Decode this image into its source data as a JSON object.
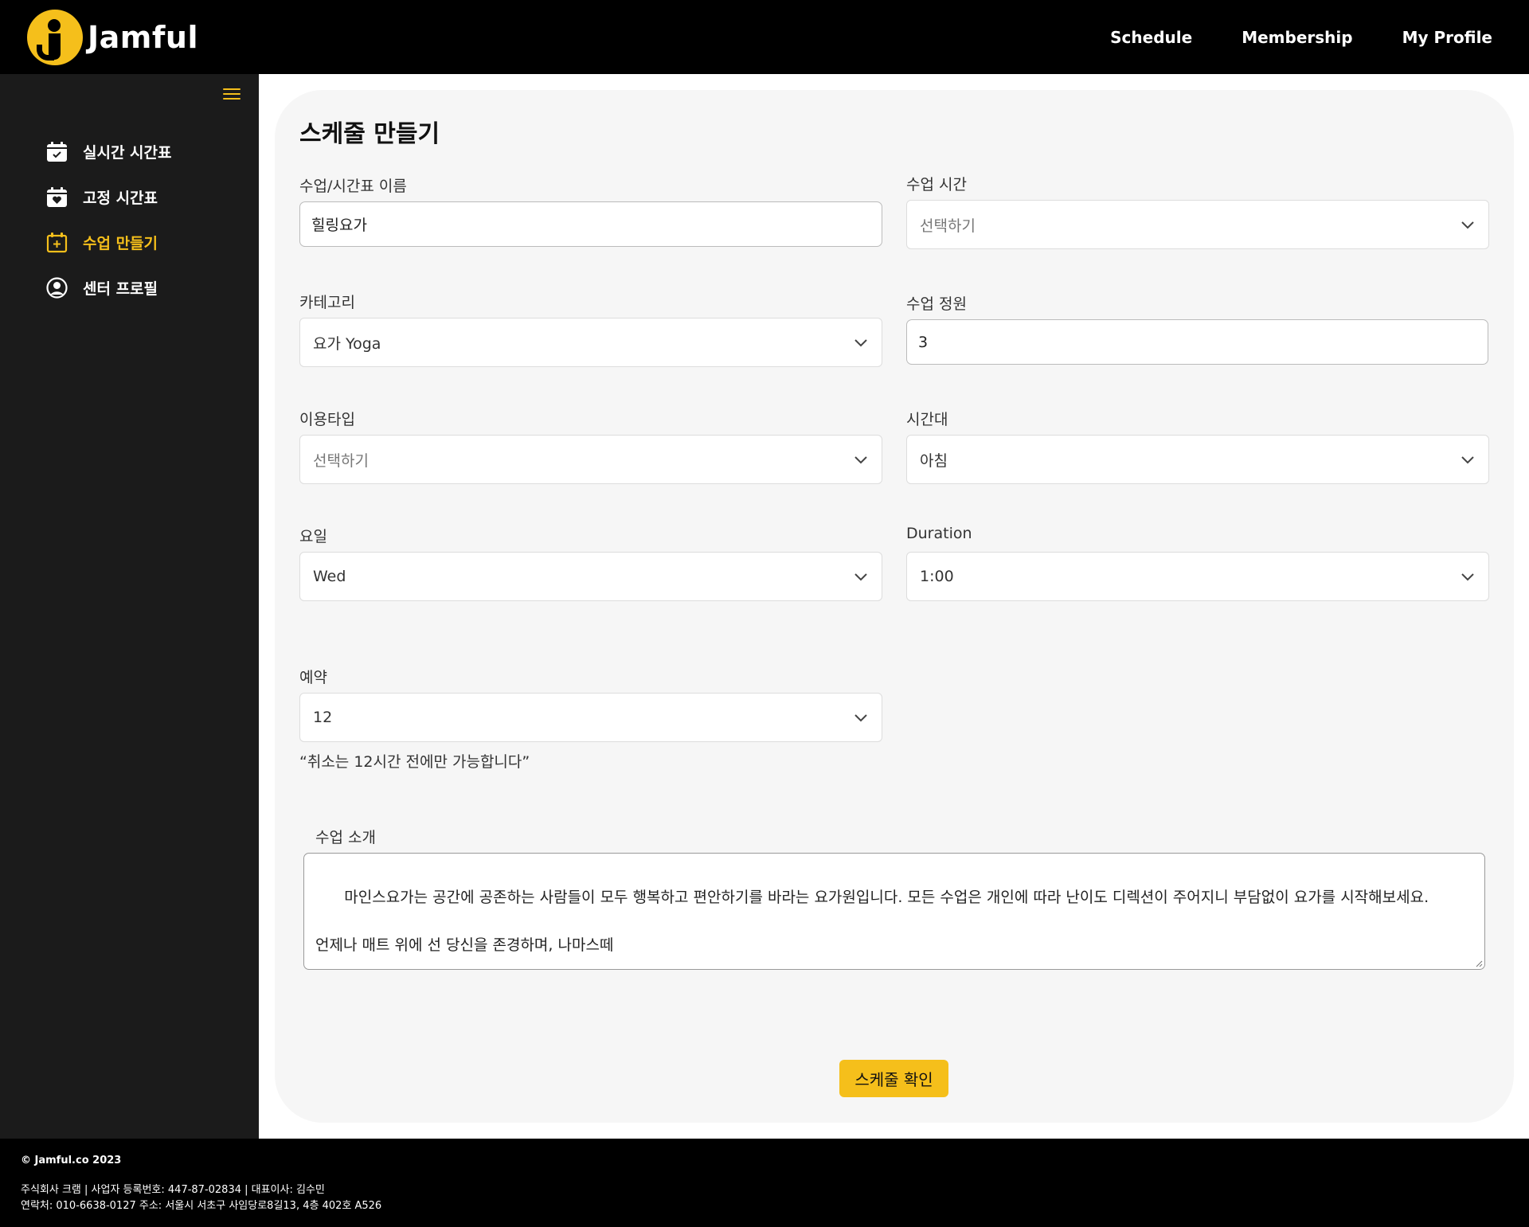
{
  "header": {
    "logo_text": "Jamful",
    "nav": [
      {
        "label": "Schedule"
      },
      {
        "label": "Membership"
      },
      {
        "label": "My Profile"
      }
    ]
  },
  "sidebar": {
    "items": [
      {
        "label": "실시간 시간표",
        "icon": "calendar-check-icon",
        "active": false
      },
      {
        "label": "고정 시간표",
        "icon": "calendar-heart-icon",
        "active": false
      },
      {
        "label": "수업 만들기",
        "icon": "calendar-plus-icon",
        "active": true
      },
      {
        "label": "센터 프로필",
        "icon": "user-circle-icon",
        "active": false
      }
    ]
  },
  "form": {
    "title": "스케줄 만들기",
    "class_name": {
      "label": "수업/시간표 이름",
      "value": "힐링요가"
    },
    "class_time": {
      "label": "수업 시간",
      "value": "선택하기"
    },
    "category": {
      "label": "카테고리",
      "value": "요가 Yoga"
    },
    "capacity": {
      "label": "수업 정원",
      "value": "3"
    },
    "usage_type": {
      "label": "이용타입",
      "value": "선택하기"
    },
    "time_slot": {
      "label": "시간대",
      "value": "아침"
    },
    "weekday": {
      "label": "요일",
      "value": "Wed"
    },
    "duration": {
      "label": "Duration",
      "value": "1:00"
    },
    "reservation": {
      "label": "예약",
      "value": "12",
      "note": "“취소는 12시간 전에만 가능합니다”"
    },
    "intro": {
      "label": "수업 소개",
      "value": "마인스요가는 공간에 공존하는 사람들이 모두 행복하고 편안하기를 바라는 요가원입니다. 모든 수업은 개인에 따라 난이도 디렉션이 주어지니 부담없이 요가를 시작해보세요.\n\n언제나 매트 위에 선 당신을 존경하며, 나마스떼"
    },
    "submit_label": "스케줄 확인"
  },
  "footer": {
    "copyright": "© Jamful.co 2023",
    "line1": "주식회사 크램 | 사업자 등록번호: 447-87-02834 | 대표이사: 김수민",
    "line2": "연락처: 010-6638-0127 주소: 서울시 서초구 사임당로8길13, 4층 402호 A526"
  },
  "colors": {
    "accent": "#f5bf1b",
    "sidebar_bg": "#1b1b1b",
    "header_bg": "#000000",
    "card_bg": "#f6f6f6"
  }
}
